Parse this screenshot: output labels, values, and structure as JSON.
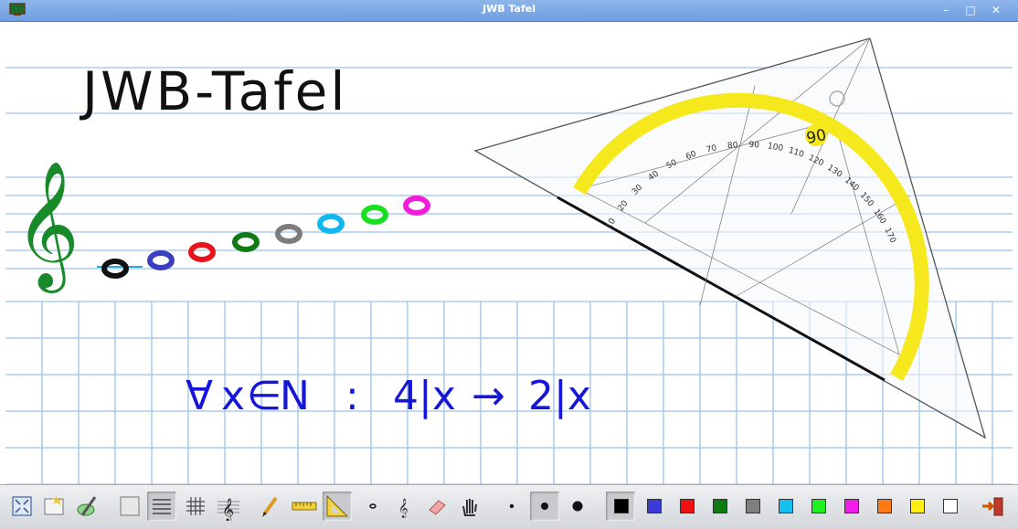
{
  "window": {
    "title": "JWB Tafel"
  },
  "board": {
    "heading": "JWB-Tafel",
    "formula_parts": {
      "forall": "∀",
      "var": "x",
      "elem": "∈",
      "set": "N",
      "colon": ":",
      "premise": "4|x",
      "arrow": "→",
      "conclusion": "2|x"
    }
  },
  "set_square": {
    "protractor_labels": [
      "10",
      "20",
      "30",
      "40",
      "50",
      "60",
      "70",
      "80",
      "90",
      "100",
      "110",
      "120",
      "130",
      "140",
      "150",
      "160",
      "170"
    ],
    "highlight_label": "90"
  },
  "notes": {
    "colors": [
      "#111111",
      "#3b3fbf",
      "#e8141b",
      "#0f7a16",
      "#7d7d7d",
      "#10b8f0",
      "#18e021",
      "#f01cd8"
    ]
  },
  "toolbar": {
    "palette": [
      "#000000",
      "#3a3ad8",
      "#ee1111",
      "#0d7a12",
      "#7f7f7f",
      "#13c0ef",
      "#1ff01f",
      "#f01ee6",
      "#ff7a12",
      "#ffef10",
      "#ffffff"
    ],
    "icons": [
      "fullscreen-icon",
      "open-file-icon",
      "save-icon",
      "blank-paper-icon",
      "lined-paper-icon",
      "grid-paper-icon",
      "music-staff-icon",
      "pencil-icon",
      "ruler-icon",
      "set-square-icon",
      "small-note-icon",
      "treble-clef-icon",
      "eraser-icon",
      "hand-icon",
      "dot-small-icon",
      "dot-medium-icon",
      "dot-large-icon",
      "exit-icon"
    ]
  }
}
